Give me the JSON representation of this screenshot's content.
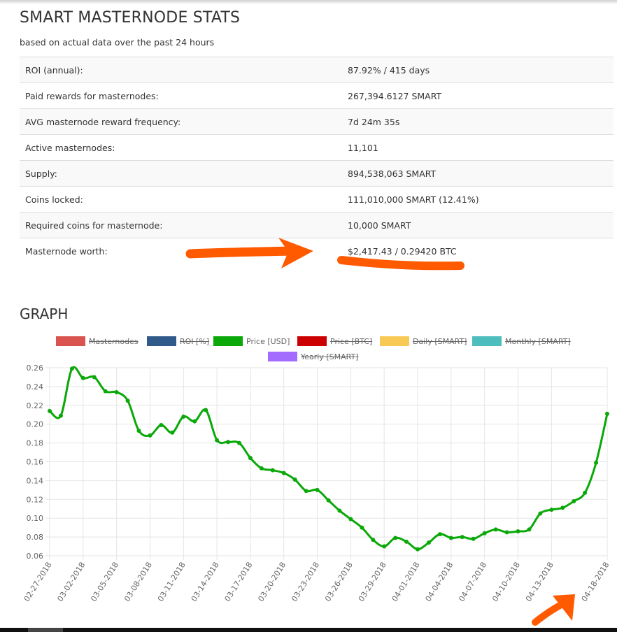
{
  "stats": {
    "title": "SMART MASTERNODE STATS",
    "subtitle": "based on actual data over the past 24 hours",
    "rows": [
      {
        "label": "ROI (annual):",
        "value": "87.92% / 415 days"
      },
      {
        "label": "Paid rewards for masternodes:",
        "value": "267,394.6127 SMART"
      },
      {
        "label": "AVG masternode reward frequency:",
        "value": "7d 24m 35s"
      },
      {
        "label": "Active masternodes:",
        "value": "11,101"
      },
      {
        "label": "Supply:",
        "value": "894,538,063 SMART"
      },
      {
        "label": "Coins locked:",
        "value": "111,010,000 SMART (12.41%)"
      },
      {
        "label": "Required coins for masternode:",
        "value": "10,000 SMART"
      },
      {
        "label": "Masternode worth:",
        "value": "$2,417.43 / 0.29420 BTC"
      }
    ]
  },
  "graph": {
    "title": "GRAPH",
    "legend": [
      {
        "label": "Masternodes",
        "color": "#d9534f",
        "hidden": true
      },
      {
        "label": "ROI [%]",
        "color": "#2f5a8a",
        "hidden": true
      },
      {
        "label": "Price [USD]",
        "color": "#0aa808",
        "hidden": false
      },
      {
        "label": "Price [BTC]",
        "color": "#cc0000",
        "hidden": true
      },
      {
        "label": "Daily [SMART]",
        "color": "#f8c954",
        "hidden": true
      },
      {
        "label": "Monthly [SMART]",
        "color": "#4dbdbd",
        "hidden": true
      },
      {
        "label": "Yearly [SMART]",
        "color": "#a36cff",
        "hidden": true
      }
    ]
  },
  "annotations": {
    "color": "#ff5a00"
  },
  "chart_data": {
    "type": "line",
    "series": [
      {
        "name": "Price [USD]",
        "color": "#0aa808",
        "values": [
          0.214,
          0.209,
          0.259,
          0.249,
          0.25,
          0.235,
          0.234,
          0.225,
          0.193,
          0.188,
          0.199,
          0.191,
          0.208,
          0.203,
          0.215,
          0.183,
          0.181,
          0.18,
          0.164,
          0.153,
          0.151,
          0.148,
          0.141,
          0.129,
          0.13,
          0.119,
          0.108,
          0.099,
          0.09,
          0.077,
          0.07,
          0.079,
          0.075,
          0.067,
          0.074,
          0.083,
          0.079,
          0.08,
          0.078,
          0.084,
          0.088,
          0.085,
          0.086,
          0.088,
          0.105,
          0.109,
          0.111,
          0.118,
          0.127,
          0.159,
          0.211
        ]
      }
    ],
    "x_start": "2018-02-27",
    "x_end": "2018-04-18",
    "x_tick_labels": [
      "02-27-2018",
      "03-02-2018",
      "03-05-2018",
      "03-08-2018",
      "03-11-2018",
      "03-14-2018",
      "03-17-2018",
      "03-20-2018",
      "03-23-2018",
      "03-26-2018",
      "03-29-2018",
      "04-01-2018",
      "04-04-2018",
      "04-07-2018",
      "04-10-2018",
      "04-13-2018",
      "04-18-2018"
    ],
    "y_ticks": [
      0.26,
      0.24,
      0.22,
      0.2,
      0.18,
      0.16,
      0.14,
      0.12,
      0.1,
      0.08,
      0.06
    ],
    "ylim": [
      0.06,
      0.26
    ],
    "grid": true
  }
}
